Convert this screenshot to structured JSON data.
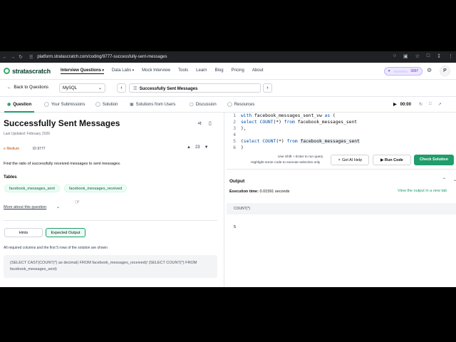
{
  "browser": {
    "url": "platform.stratascratch.com/coding/9777-successfully-sent-messages"
  },
  "topnav": {
    "logo": "stratascratch",
    "items": [
      "Interview Questions",
      "Data Labs",
      "Mock Interview",
      "Tools",
      "Learn",
      "Blog",
      "Pricing",
      "About"
    ],
    "points": "3997",
    "avatar_initial": "P"
  },
  "subbar": {
    "back_label": "Back to Questions",
    "language": "MySQL",
    "question_select": "Successfully Sent Messages"
  },
  "tabs": {
    "items": [
      "Question",
      "Your Submissions",
      "Solution",
      "Solutions from Users",
      "Discussion",
      "Resources"
    ],
    "active": "Question",
    "timer": "00:00"
  },
  "question": {
    "title": "Successfully Sent Messages",
    "last_updated": "Last Updated: February 2026",
    "difficulty": "Medium",
    "id": "ID 9777",
    "votes": "23",
    "description": "Find the ratio of successfully received messages to sent messages.",
    "tables_heading": "Tables",
    "tables": [
      "facebook_messages_sent",
      "facebook_messages_received"
    ],
    "more_label": "More about this question",
    "hints_label": "Hints",
    "expected_label": "Expected Output",
    "required_note": "All required columns and the first 5 rows of the solution are shown",
    "solution_expr": "(SELECT CAST(COUNT(*) as decimal) FROM facebook_messages_received)/ (SELECT COUNT(*) FROM facebook_messages_sent)"
  },
  "editor": {
    "line_numbers": [
      "1",
      "2",
      "3",
      "4",
      "5",
      "6"
    ],
    "hint_run": "Use Shift + Enter to run query",
    "hint_select": "Highlight some code to execute selection only",
    "ai_label": "Get AI Help",
    "run_label": "Run Code",
    "check_label": "Check Solution"
  },
  "output": {
    "title": "Output",
    "exec_label": "Execution time:",
    "exec_value": "0.01591 seconds",
    "view_link": "View the output in a new tab",
    "column": "COUNT(*)",
    "value": "5"
  },
  "colors": {
    "accent": "#1f9d6b",
    "brand_dark": "#0b3d2e"
  }
}
